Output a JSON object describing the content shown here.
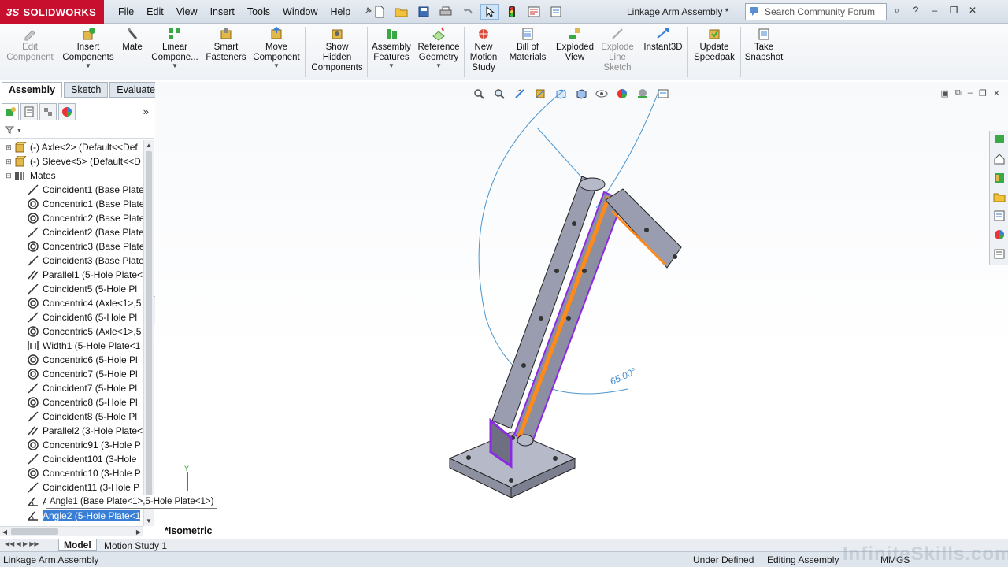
{
  "app": {
    "logo_text": "SOLIDWORKS",
    "logo_prefix": "3S",
    "document_title": "Linkage Arm Assembly *"
  },
  "menu": [
    "File",
    "Edit",
    "View",
    "Insert",
    "Tools",
    "Window",
    "Help"
  ],
  "search": {
    "placeholder": "Search Community Forum"
  },
  "command_manager": [
    {
      "label": "Edit\nComponent",
      "icon": "edit-component-icon",
      "disabled": true
    },
    {
      "label": "Insert\nComponents",
      "icon": "insert-components-icon"
    },
    {
      "label": "Mate",
      "icon": "mate-icon"
    },
    {
      "label": "Linear\nCompone...",
      "icon": "linear-pattern-icon"
    },
    {
      "label": "Smart\nFasteners",
      "icon": "smart-fasteners-icon"
    },
    {
      "label": "Move\nComponent",
      "icon": "move-component-icon"
    },
    {
      "label": "Show\nHidden\nComponents",
      "icon": "show-hidden-icon"
    },
    {
      "label": "Assembly\nFeatures",
      "icon": "assembly-features-icon"
    },
    {
      "label": "Reference\nGeometry",
      "icon": "reference-geometry-icon"
    },
    {
      "label": "New\nMotion\nStudy",
      "icon": "motion-study-icon"
    },
    {
      "label": "Bill of\nMaterials",
      "icon": "bom-icon"
    },
    {
      "label": "Exploded\nView",
      "icon": "exploded-view-icon"
    },
    {
      "label": "Explode\nLine\nSketch",
      "icon": "explode-line-icon",
      "disabled": true
    },
    {
      "label": "Instant3D",
      "icon": "instant3d-icon"
    },
    {
      "label": "Update\nSpeedpak",
      "icon": "speedpak-icon"
    },
    {
      "label": "Take\nSnapshot",
      "icon": "snapshot-icon"
    }
  ],
  "tabs": [
    "Assembly",
    "Sketch",
    "Evaluate"
  ],
  "tree": [
    {
      "label": "(-) Axle<2> (Default<<Def",
      "icon": "part",
      "expander": "+"
    },
    {
      "label": "(-) Sleeve<5> (Default<<D",
      "icon": "part",
      "expander": "+"
    },
    {
      "label": "Mates",
      "icon": "mates",
      "expander": "-"
    },
    {
      "label": "Coincident1 (Base Plate",
      "icon": "coincident"
    },
    {
      "label": "Concentric1 (Base Plate",
      "icon": "concentric"
    },
    {
      "label": "Concentric2 (Base Plate",
      "icon": "concentric"
    },
    {
      "label": "Coincident2 (Base Plate",
      "icon": "coincident"
    },
    {
      "label": "Concentric3 (Base Plate",
      "icon": "concentric"
    },
    {
      "label": "Coincident3 (Base Plate",
      "icon": "coincident"
    },
    {
      "label": "Parallel1 (5-Hole Plate<",
      "icon": "parallel"
    },
    {
      "label": "Coincident5 (5-Hole Pl",
      "icon": "coincident"
    },
    {
      "label": "Concentric4 (Axle<1>,5",
      "icon": "concentric"
    },
    {
      "label": "Coincident6 (5-Hole Pl",
      "icon": "coincident"
    },
    {
      "label": "Concentric5 (Axle<1>,5",
      "icon": "concentric"
    },
    {
      "label": "Width1 (5-Hole Plate<1",
      "icon": "width"
    },
    {
      "label": "Concentric6 (5-Hole Pl",
      "icon": "concentric"
    },
    {
      "label": "Concentric7 (5-Hole Pl",
      "icon": "concentric"
    },
    {
      "label": "Coincident7 (5-Hole Pl",
      "icon": "coincident"
    },
    {
      "label": "Concentric8 (5-Hole Pl",
      "icon": "concentric"
    },
    {
      "label": "Coincident8 (5-Hole Pl",
      "icon": "coincident"
    },
    {
      "label": "Parallel2 (3-Hole Plate<",
      "icon": "parallel"
    },
    {
      "label": "Concentric91 (3-Hole P",
      "icon": "concentric"
    },
    {
      "label": "Coincident101 (3-Hole",
      "icon": "coincident"
    },
    {
      "label": "Concentric10 (3-Hole P",
      "icon": "concentric"
    },
    {
      "label": "Coincident11 (3-Hole P",
      "icon": "coincident"
    },
    {
      "label": "Angle1",
      "icon": "angle"
    },
    {
      "label": "Angle2 (5-Hole Plate<1",
      "icon": "angle",
      "selected": true
    }
  ],
  "tooltip": "Angle1 (Base Plate<1>,5-Hole Plate<1>)",
  "graphics": {
    "view_label": "*Isometric",
    "angle_dimension": "65.00°",
    "triad_label": "Y"
  },
  "bottom_tabs": [
    "Model",
    "Motion Study 1"
  ],
  "status": {
    "left": "Linkage Arm Assembly",
    "state": "Under Defined",
    "mode": "Editing Assembly",
    "units": "MMGS",
    "watermark": "InfiniteSkills.com"
  },
  "colors": {
    "brand": "#c8102e",
    "selection": "#3a7fd6",
    "highlight_orange": "#ff8a1a",
    "highlight_purple": "#8a2be2",
    "dimension_blue": "#3d8ad0"
  }
}
